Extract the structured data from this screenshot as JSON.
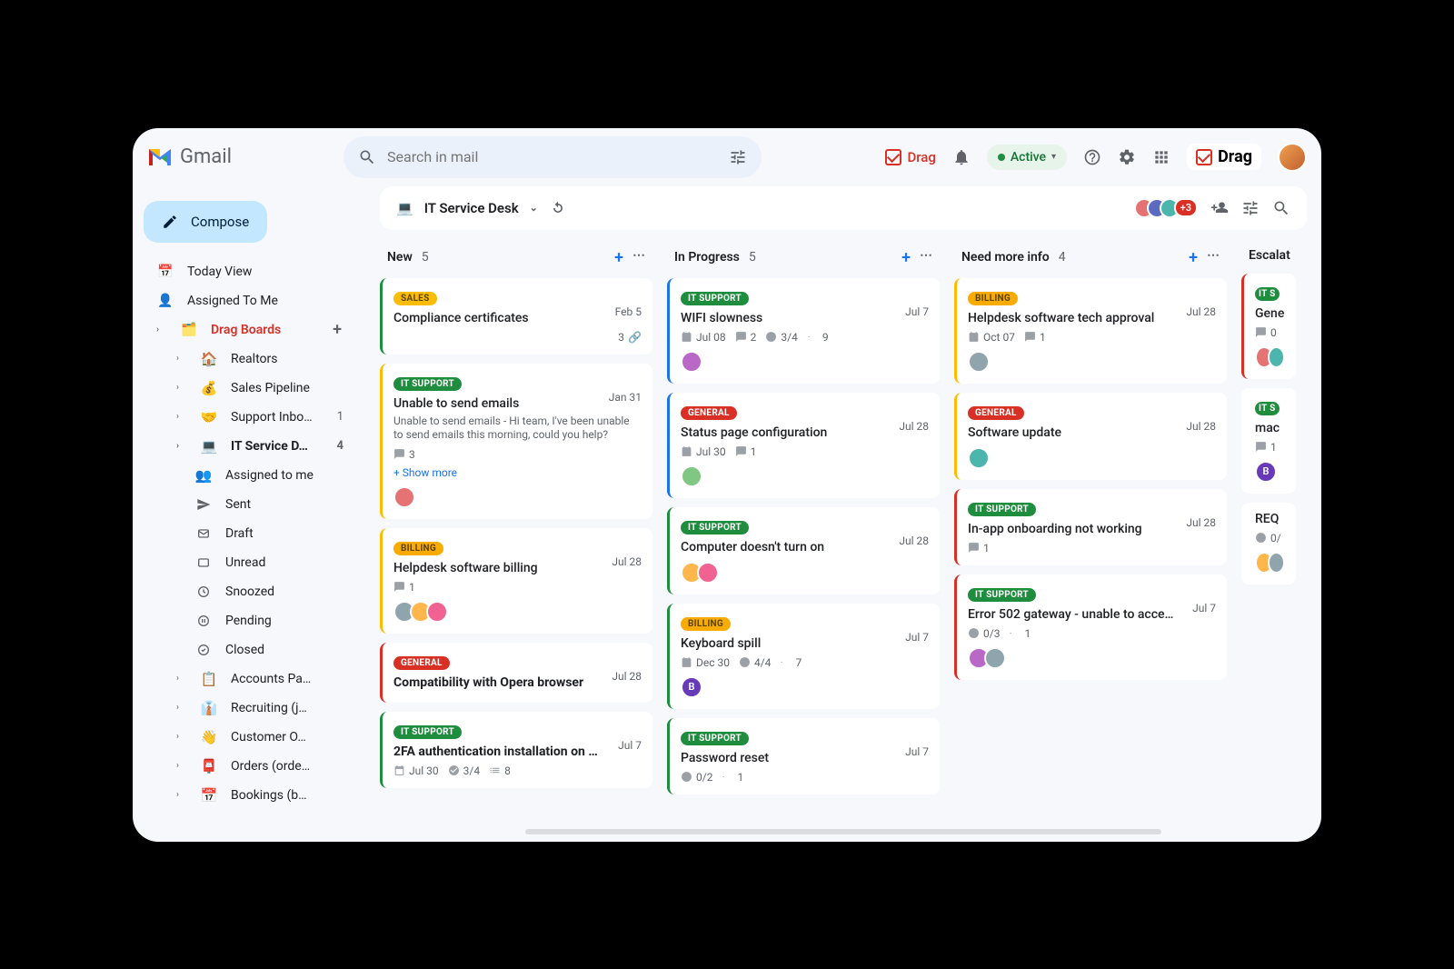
{
  "header": {
    "product": "Gmail",
    "search_placeholder": "Search in mail",
    "drag_label": "Drag",
    "active_label": "Active",
    "brand": "Drag"
  },
  "sidebar": {
    "compose": "Compose",
    "today": "Today View",
    "assigned": "Assigned To Me",
    "drag_boards": "Drag Boards",
    "boards": {
      "realtors": "Realtors",
      "sales": "Sales Pipeline",
      "support": "Support Inbo…",
      "support_count": "1",
      "itdesk": "IT Service D…",
      "itdesk_count": "4",
      "accounts": "Accounts Pa…",
      "recruiting": "Recruiting (j…",
      "customer": "Customer O…",
      "orders": "Orders (orde…",
      "bookings": "Bookings (b…"
    },
    "sub": {
      "assigned_me": "Assigned to me",
      "sent": "Sent",
      "draft": "Draft",
      "unread": "Unread",
      "snoozed": "Snoozed",
      "pending": "Pending",
      "closed": "Closed"
    }
  },
  "board": {
    "title": "IT Service Desk",
    "avatar_overflow": "+3"
  },
  "columns": [
    {
      "name": "New",
      "count": "5"
    },
    {
      "name": "In Progress",
      "count": "5"
    },
    {
      "name": "Need more info",
      "count": "4"
    },
    {
      "name": "Escalat"
    }
  ],
  "tags": {
    "sales": "SALES",
    "it": "IT SUPPORT",
    "billing": "BILLING",
    "general": "GENERAL"
  },
  "cards_new": [
    {
      "tag": "sales",
      "title": "Compliance certificates",
      "date": "Feb 5",
      "att": "3"
    },
    {
      "tag": "it",
      "title": "Unable to send emails",
      "date": "Jan 31",
      "sub": "Unable to send emails - Hi team, I've been unable to send emails this morning, could you help?",
      "comments": "3",
      "showmore": "+ Show more"
    },
    {
      "tag": "billing",
      "title": "Helpdesk software billing",
      "date": "Jul 28",
      "comments": "1"
    },
    {
      "tag": "general",
      "title": "Compatibility with Opera browser",
      "date": "Jul 28",
      "bold": true
    },
    {
      "tag": "it",
      "title": "2FA authentication installation on …",
      "date": "Jul 7",
      "bold": true,
      "cal": "Jul 30",
      "check": "3/4",
      "list": "8"
    }
  ],
  "cards_prog": [
    {
      "tag": "it",
      "title": "WIFI slowness",
      "date": "Jul 7",
      "cal": "Jul 08",
      "comments": "2",
      "check": "3/4",
      "list": "9"
    },
    {
      "tag": "general",
      "title": "Status page configuration",
      "date": "Jul 28",
      "cal": "Jul 30",
      "comments": "1"
    },
    {
      "tag": "it",
      "title": "Computer doesn't turn on",
      "date": "Jul 28"
    },
    {
      "tag": "billing",
      "title": "Keyboard spill",
      "date": "Jul 7",
      "cal": "Dec 30",
      "check": "4/4",
      "list": "7"
    },
    {
      "tag": "it",
      "title": "Password reset",
      "date": "Jul 7",
      "check": "0/2",
      "list": "1"
    }
  ],
  "cards_info": [
    {
      "tag": "billing",
      "title": "Helpdesk software tech approval",
      "date": "Jul 28",
      "cal": "Oct 07",
      "comments": "1"
    },
    {
      "tag": "general",
      "title": "Software update",
      "date": "Jul 28"
    },
    {
      "tag": "it",
      "title": "In-app onboarding not working",
      "date": "Jul 28",
      "comments": "1"
    },
    {
      "tag": "it",
      "title": "Error 502 gateway - unable to acce…",
      "date": "Jul 7",
      "check": "0/3",
      "list": "1"
    }
  ],
  "cards_esc": [
    {
      "tag": "it",
      "title": "Gene",
      "comments": "0"
    },
    {
      "tag": "it",
      "title": "mac",
      "comments": "1"
    },
    {
      "title": "REQ",
      "check": "0/"
    }
  ]
}
